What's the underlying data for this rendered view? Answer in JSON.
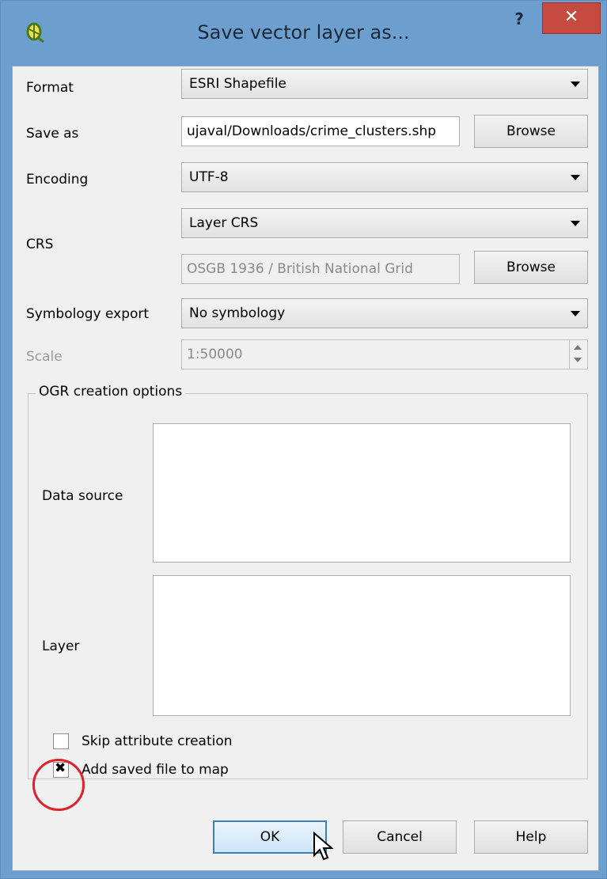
{
  "window": {
    "title": "Save vector layer as...",
    "help_label": "?",
    "close_label": "✕"
  },
  "form": {
    "format_label": "Format",
    "format_value": "ESRI Shapefile",
    "save_as_label": "Save as",
    "save_as_value": "ujaval/Downloads/crime_clusters.shp",
    "browse_label": "Browse",
    "encoding_label": "Encoding",
    "encoding_value": "UTF-8",
    "crs_label": "CRS",
    "crs_mode_value": "Layer CRS",
    "crs_value": "OSGB 1936 / British National Grid",
    "crs_browse_label": "Browse",
    "symbology_label": "Symbology export",
    "symbology_value": "No symbology",
    "scale_label": "Scale",
    "scale_value": "1:50000"
  },
  "ogr": {
    "group_title": "OGR creation options",
    "data_source_label": "Data source",
    "layer_label": "Layer"
  },
  "options": {
    "skip_attr_label": "Skip attribute creation",
    "skip_attr_checked": false,
    "add_to_map_label": "Add saved file to map",
    "add_to_map_checked": true
  },
  "buttons": {
    "ok": "OK",
    "cancel": "Cancel",
    "help": "Help"
  },
  "colors": {
    "title_bar": "#6d9fce",
    "close_button": "#c74a40",
    "annotation_circle": "#e0202a"
  }
}
